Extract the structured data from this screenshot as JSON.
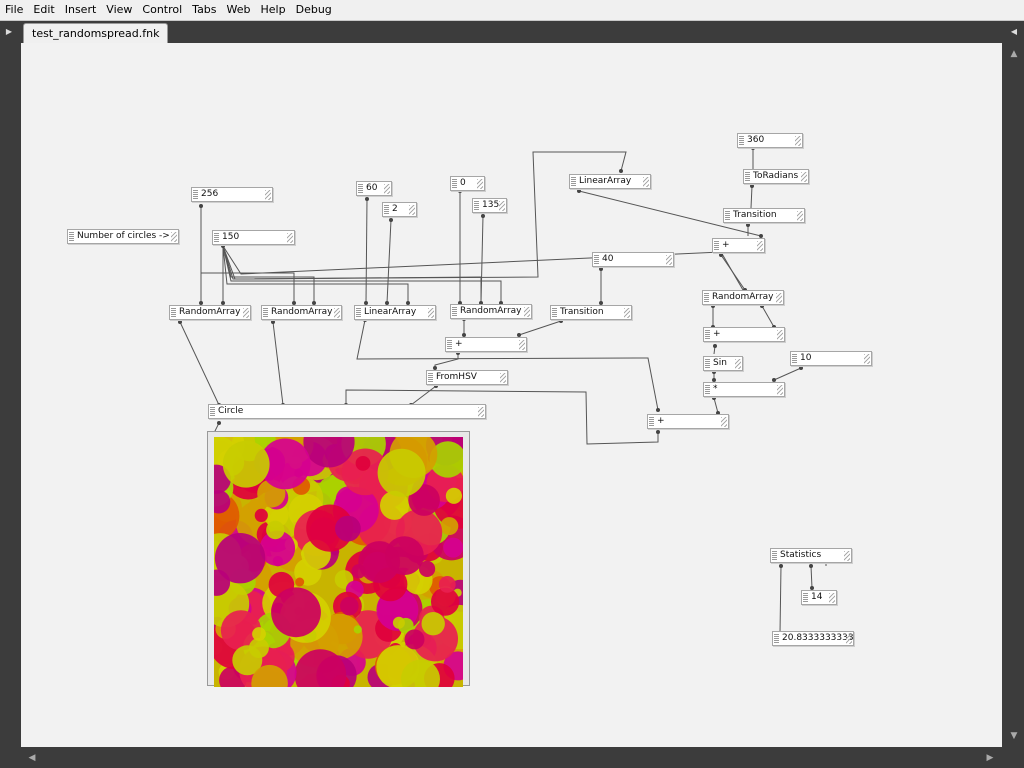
{
  "menu": [
    "File",
    "Edit",
    "Insert",
    "View",
    "Control",
    "Tabs",
    "Web",
    "Help",
    "Debug"
  ],
  "tab": {
    "label": "test_randomspread.fnk"
  },
  "nodes": {
    "n_label": "Number of circles ->",
    "n256": "256",
    "n150": "150",
    "n60": "60",
    "n2": "2",
    "n0": "0",
    "n135": "135",
    "linear_top": "LinearArray",
    "n360": "360",
    "toradians": "ToRadians",
    "trans_top": "Transition",
    "plus_top": "+",
    "n40": "40",
    "random1": "RandomArray",
    "random2": "RandomArray",
    "linear2": "LinearArray",
    "random3": "RandomArray",
    "trans_mid": "Transition",
    "random4": "RandomArray",
    "plus_mid": "+",
    "plus_r": "+",
    "sin": "Sin",
    "n10": "10",
    "mul": "*",
    "fromhsv": "FromHSV",
    "circle": "Circle",
    "plus_low": "+",
    "statistics": "Statistics",
    "n14": "14",
    "stat_value": "20.8333333333"
  },
  "colors": {
    "canvas_bg": "#f2f2f2",
    "wire": "#555555",
    "chrome": "#3c3c3c",
    "preview_bg": "#c8b400",
    "circle_palette": [
      "#e0003c",
      "#d60090",
      "#c8cc00",
      "#e05a00",
      "#d4a000",
      "#cc0060",
      "#a8d400",
      "#e82050",
      "#b8007a",
      "#d4d000"
    ]
  },
  "icons": {
    "tab_left": "triangle-right-icon",
    "tab_right": "triangle-left-icon",
    "scroll_up": "triangle-up-icon",
    "scroll_down": "triangle-down-icon",
    "scroll_left": "triangle-left-icon",
    "scroll_right": "triangle-right-icon"
  }
}
